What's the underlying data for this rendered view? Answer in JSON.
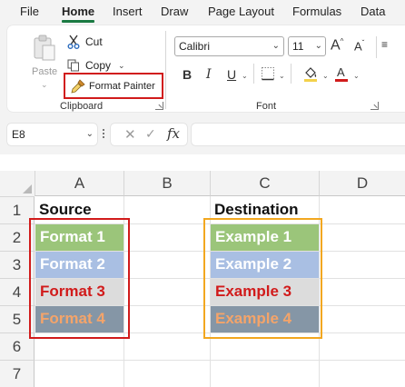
{
  "tabs": [
    {
      "label": "File",
      "active": false
    },
    {
      "label": "Home",
      "active": true
    },
    {
      "label": "Insert",
      "active": false
    },
    {
      "label": "Draw",
      "active": false
    },
    {
      "label": "Page Layout",
      "active": false
    },
    {
      "label": "Formulas",
      "active": false
    },
    {
      "label": "Data",
      "active": false
    }
  ],
  "clipboard": {
    "paste_label": "Paste",
    "cut_label": "Cut",
    "copy_label": "Copy",
    "format_painter_label": "Format Painter",
    "group_label": "Clipboard",
    "icons": [
      "paste-icon",
      "scissors-icon",
      "copy-icon",
      "paintbrush-icon"
    ]
  },
  "font": {
    "font_name": "Calibri",
    "font_size": "11",
    "group_label": "Font",
    "bold_label": "B",
    "italic_label": "I",
    "underline_label": "U",
    "grow_label": "A",
    "shrink_label": "A",
    "icons": [
      "grow-font-icon",
      "shrink-font-icon",
      "fill-color-icon",
      "font-color-icon",
      "borders-icon",
      "text-direction-icon"
    ]
  },
  "formula_bar": {
    "name_box": "E8",
    "cancel_symbol": "✕",
    "enter_symbol": "✓",
    "fx_label": "fx",
    "formula": ""
  },
  "grid": {
    "columns": [
      "A",
      "B",
      "C",
      "D"
    ],
    "rows": [
      "1",
      "2",
      "3",
      "4",
      "5",
      "6",
      "7"
    ],
    "cells": {
      "A1": "Source",
      "C1": "Destination",
      "A2": "Format 1",
      "A3": "Format 2",
      "A4": "Format 3",
      "A5": "Format 4",
      "C2": "Example 1",
      "C3": "Example 2",
      "C4": "Example 3",
      "C5": "Example 4"
    },
    "formats": {
      "format_1": {
        "fill": "#9bc57a",
        "text": "#ffffff"
      },
      "format_2": {
        "fill": "#a9bfe3",
        "text": "#ffffff"
      },
      "format_3": {
        "fill": "#dcdcdc",
        "text": "#d11b1b"
      },
      "format_4": {
        "fill": "#8596a6",
        "text": "#f4a46a"
      }
    }
  },
  "colors": {
    "accent": "#1a7a42",
    "source_highlight": "#d11b1b",
    "destination_highlight": "#f2a720",
    "chrome_bg": "#f3f3f3"
  }
}
